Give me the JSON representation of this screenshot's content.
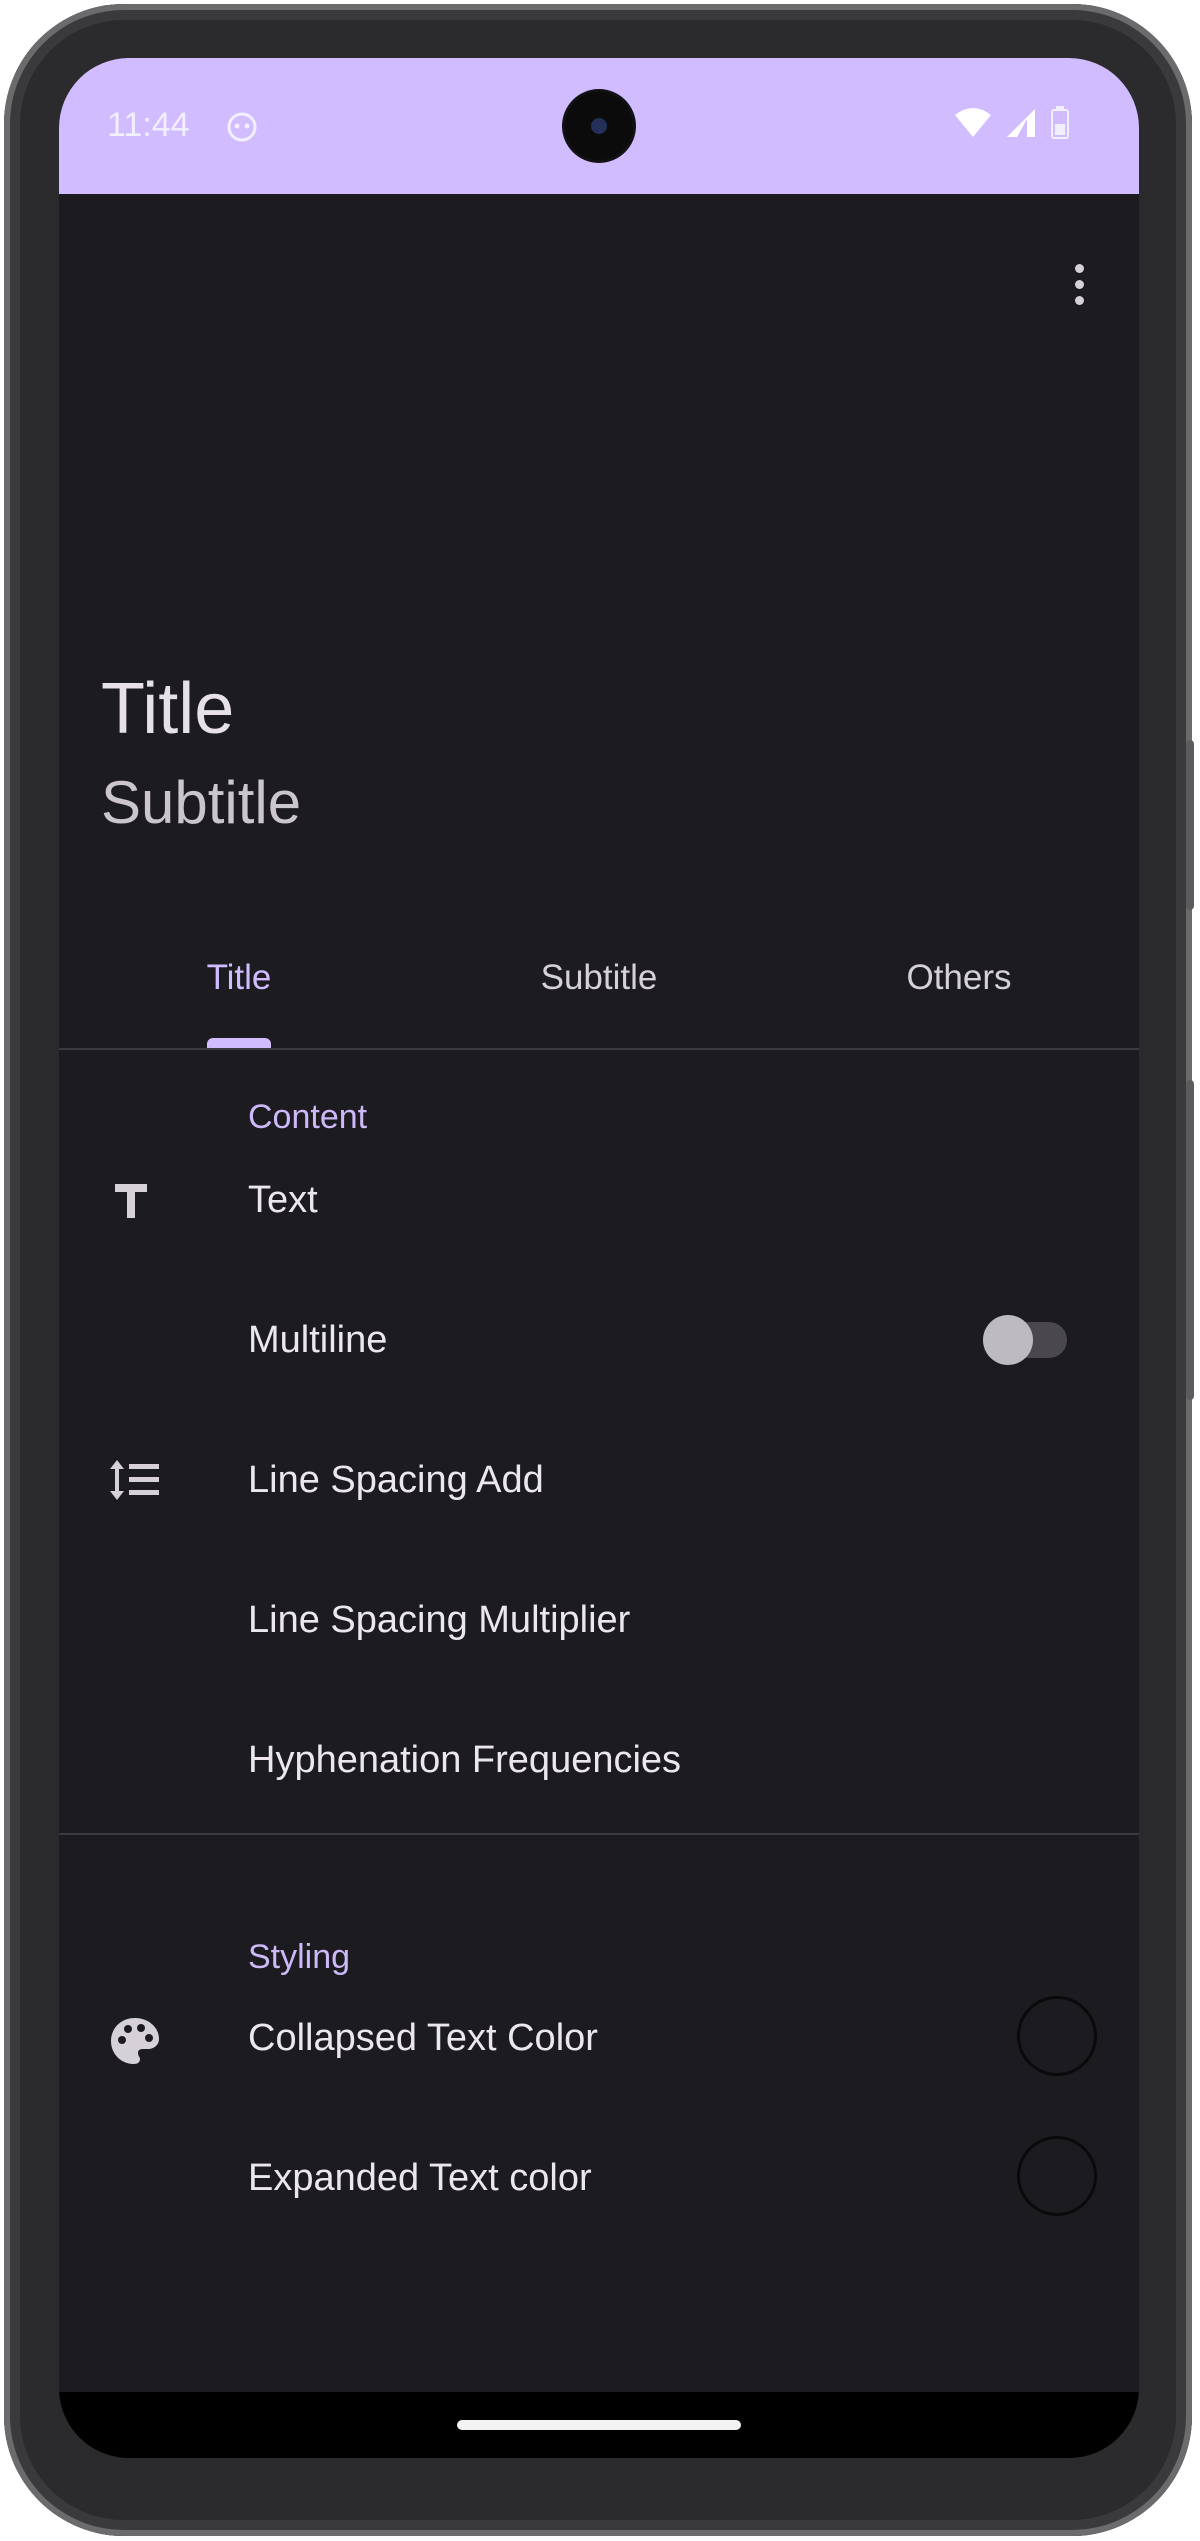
{
  "status_bar": {
    "time": "11:44",
    "background_color": "#d0bcff",
    "icons": [
      "notification-icon",
      "wifi-icon",
      "signal-icon",
      "battery-icon"
    ]
  },
  "toolbar": {
    "title": "Title",
    "subtitle": "Subtitle",
    "overflow_icon": "more-vert-icon"
  },
  "tabs": {
    "items": [
      {
        "label": "Title",
        "selected": true
      },
      {
        "label": "Subtitle",
        "selected": false
      },
      {
        "label": "Others",
        "selected": false
      }
    ],
    "accent_color": "#d0bcff"
  },
  "sections": {
    "content": {
      "label": "Content",
      "items": [
        {
          "label": "Text",
          "icon": "text-icon"
        },
        {
          "label": "Multiline",
          "control": "switch",
          "checked": false
        },
        {
          "label": "Line Spacing Add",
          "icon": "line-spacing-icon"
        },
        {
          "label": "Line Spacing Multiplier"
        },
        {
          "label": "Hyphenation Frequencies"
        }
      ]
    },
    "styling": {
      "label": "Styling",
      "items": [
        {
          "label": "Collapsed Text Color",
          "icon": "palette-icon",
          "control": "color-swatch"
        },
        {
          "label": "Expanded Text color",
          "control": "color-swatch"
        }
      ]
    }
  },
  "colors": {
    "background": "#1c1b20",
    "text_primary": "#ece7ee",
    "section_header": "#cdb9f8"
  }
}
